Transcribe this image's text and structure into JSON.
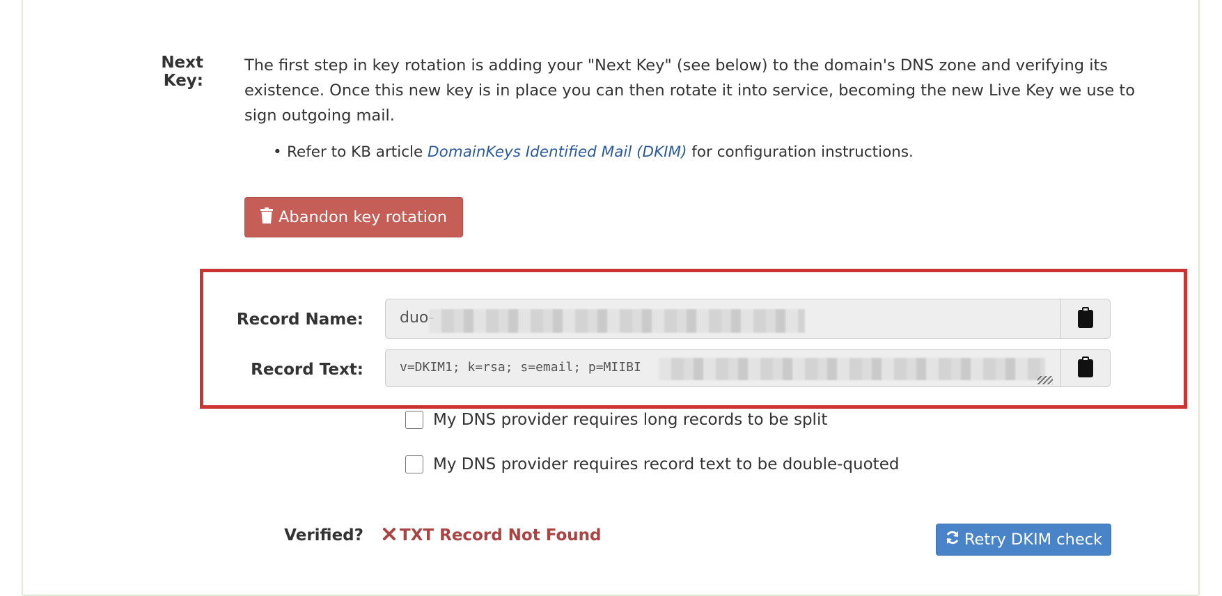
{
  "next_key": {
    "label": "Next Key:",
    "description": "The first step in key rotation is adding your \"Next Key\" (see below) to the domain's DNS zone and verifying its existence. Once this new key is in place you can then rotate it into service, becoming the new Live Key we use to sign outgoing mail.",
    "bullet_prefix": "Refer to KB article ",
    "kb_link": "DomainKeys Identified Mail (DKIM)",
    "bullet_suffix": " for configuration instructions.",
    "abandon_button": "Abandon key rotation"
  },
  "record": {
    "name_label": "Record Name:",
    "name_value": "duo-",
    "text_label": "Record Text:",
    "text_value": "v=DKIM1; k=rsa; s=email; p=MIIBI"
  },
  "options": {
    "split_label": "My DNS provider requires long records to be split",
    "quote_label": "My DNS provider requires record text to be double-quoted"
  },
  "verification": {
    "label": "Verified?",
    "status": "TXT Record Not Found",
    "retry_button": "Retry DKIM check"
  },
  "colors": {
    "danger": "#c65e58",
    "primary": "#4a84c8",
    "error_text": "#a94442",
    "highlight": "#cc3333"
  }
}
